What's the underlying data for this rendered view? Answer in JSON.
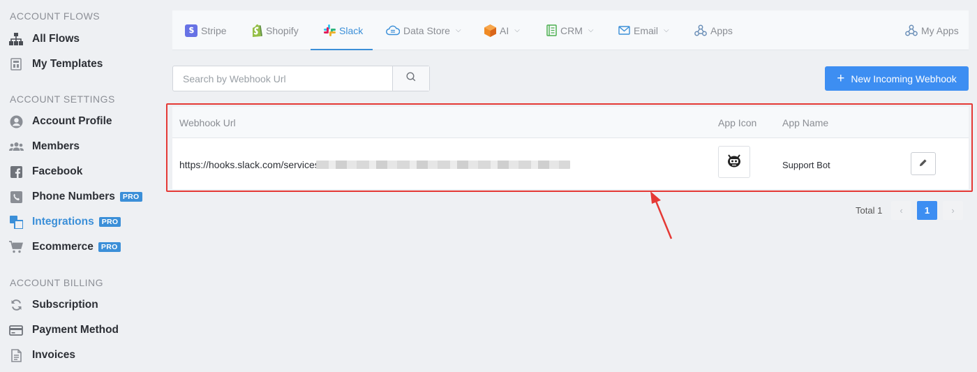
{
  "sidebar": {
    "sections": [
      {
        "title": "ACCOUNT FLOWS"
      },
      {
        "title": "ACCOUNT SETTINGS"
      },
      {
        "title": "ACCOUNT BILLING"
      }
    ],
    "items": [
      {
        "label": "All Flows",
        "icon": "sitemap-icon"
      },
      {
        "label": "My Templates",
        "icon": "template-icon"
      },
      {
        "label": "Account Profile",
        "icon": "user-circle-icon"
      },
      {
        "label": "Members",
        "icon": "members-icon"
      },
      {
        "label": "Facebook",
        "icon": "facebook-icon"
      },
      {
        "label": "Phone Numbers",
        "icon": "phone-icon",
        "badge": "PRO"
      },
      {
        "label": "Integrations",
        "icon": "integrations-icon",
        "badge": "PRO",
        "active": true
      },
      {
        "label": "Ecommerce",
        "icon": "cart-icon",
        "badge": "PRO"
      },
      {
        "label": "Subscription",
        "icon": "refresh-icon"
      },
      {
        "label": "Payment Method",
        "icon": "credit-card-icon"
      },
      {
        "label": "Invoices",
        "icon": "invoice-icon"
      }
    ],
    "active_color": "#3b8fd8"
  },
  "tabs": [
    {
      "label": "Stripe",
      "icon": "stripe-icon"
    },
    {
      "label": "Shopify",
      "icon": "shopify-icon"
    },
    {
      "label": "Slack",
      "icon": "slack-icon",
      "active": true
    },
    {
      "label": "Data Store",
      "icon": "cloud-icon",
      "dropdown": true
    },
    {
      "label": "AI",
      "icon": "ai-cube-icon",
      "dropdown": true
    },
    {
      "label": "CRM",
      "icon": "crm-icon",
      "dropdown": true
    },
    {
      "label": "Email",
      "icon": "mail-icon",
      "dropdown": true
    },
    {
      "label": "Apps",
      "icon": "webhook-icon"
    },
    {
      "label": "My Apps",
      "icon": "webhook-icon"
    }
  ],
  "search": {
    "placeholder": "Search by Webhook Url"
  },
  "new_button": {
    "label": "New Incoming Webhook"
  },
  "table": {
    "columns": [
      "Webhook Url",
      "App Icon",
      "App Name"
    ],
    "rows": [
      {
        "url": "https://hooks.slack.com/services",
        "app_name": "Support Bot",
        "app_icon": "bot-icon"
      }
    ]
  },
  "pagination": {
    "total_label": "Total 1",
    "current": "1",
    "prev": "‹",
    "next": "›"
  },
  "colors": {
    "primary": "#3d8ef2",
    "highlight": "#e53935",
    "pro_badge": "#3b8fd8"
  }
}
